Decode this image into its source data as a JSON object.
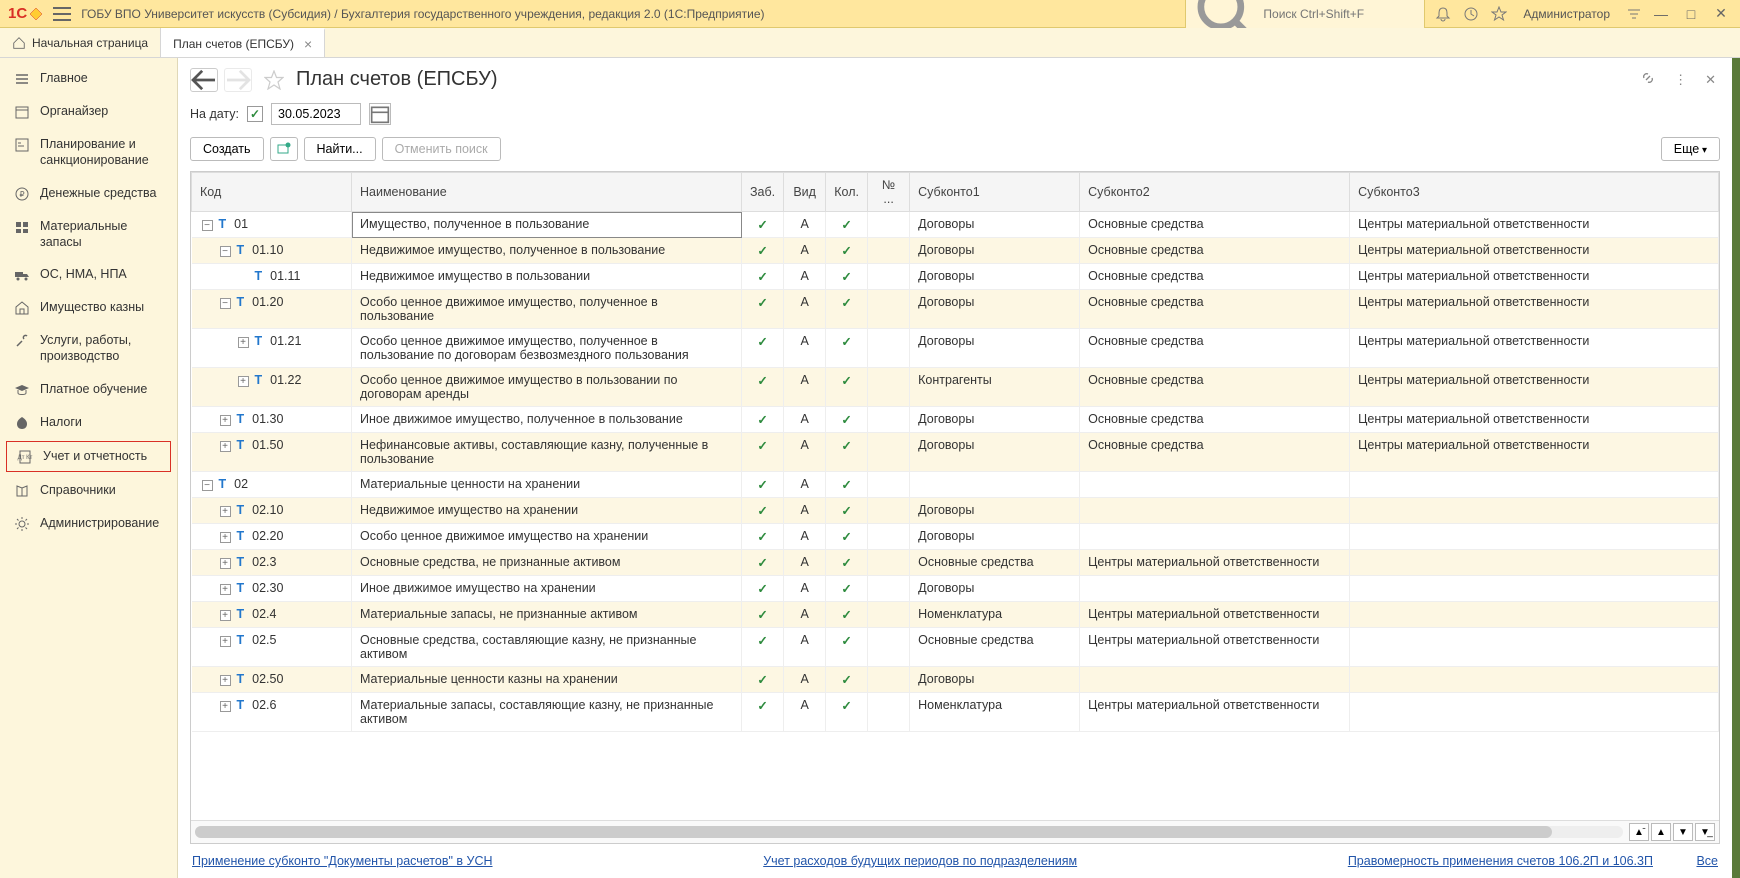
{
  "titlebar": {
    "title": "ГОБУ ВПО Университет искусств (Субсидия) / Бухгалтерия государственного учреждения, редакция 2.0  (1С:Предприятие)",
    "search_placeholder": "Поиск Ctrl+Shift+F",
    "admin": "Администратор"
  },
  "tabs": {
    "home": "Начальная страница",
    "open": "План счетов (ЕПСБУ)"
  },
  "sidebar": [
    {
      "label": "Главное",
      "icon": "lines"
    },
    {
      "label": "Органайзер",
      "icon": "calendar"
    },
    {
      "label": "Планирование и санкционирование",
      "icon": "plan"
    },
    {
      "label": "Денежные средства",
      "icon": "ruble"
    },
    {
      "label": "Материальные запасы",
      "icon": "boxes"
    },
    {
      "label": "ОС, НМА, НПА",
      "icon": "truck"
    },
    {
      "label": "Имущество казны",
      "icon": "building"
    },
    {
      "label": "Услуги, работы, производство",
      "icon": "tools"
    },
    {
      "label": "Платное обучение",
      "icon": "gradcap"
    },
    {
      "label": "Налоги",
      "icon": "eagle"
    },
    {
      "label": "Учет и отчетность",
      "icon": "report",
      "selected": true
    },
    {
      "label": "Справочники",
      "icon": "book"
    },
    {
      "label": "Администрирование",
      "icon": "gear"
    }
  ],
  "page": {
    "title": "План счетов (ЕПСБУ)",
    "date_label": "На дату:",
    "date_value": "30.05.2023",
    "date_checked": true
  },
  "toolbar": {
    "create": "Создать",
    "find": "Найти...",
    "cancel_search": "Отменить поиск",
    "more": "Еще"
  },
  "columns": {
    "code": "Код",
    "name": "Наименование",
    "zab": "Заб.",
    "vid": "Вид",
    "kol": "Кол.",
    "num": "№ ...",
    "sub1": "Субконто1",
    "sub2": "Субконто2",
    "sub3": "Субконто3"
  },
  "rows": [
    {
      "indent": 0,
      "toggle": "minus",
      "code": "01",
      "name": "Имущество, полученное в пользование",
      "zab": true,
      "vid": "А",
      "kol": true,
      "num": "",
      "sub1": "Договоры",
      "sub2": "Основные средства",
      "sub3": "Центры материальной ответственности",
      "selected": true,
      "even": false
    },
    {
      "indent": 1,
      "toggle": "minus",
      "code": "01.10",
      "name": "Недвижимое имущество, полученное в пользование",
      "zab": true,
      "vid": "А",
      "kol": true,
      "num": "",
      "sub1": "Договоры",
      "sub2": "Основные средства",
      "sub3": "Центры материальной ответственности",
      "even": true
    },
    {
      "indent": 2,
      "toggle": "empty",
      "code": "01.11",
      "name": "Недвижимое имущество в пользовании",
      "zab": true,
      "vid": "А",
      "kol": true,
      "num": "",
      "sub1": "Договоры",
      "sub2": "Основные средства",
      "sub3": "Центры материальной ответственности",
      "even": false
    },
    {
      "indent": 1,
      "toggle": "minus",
      "code": "01.20",
      "name": "Особо ценное движимое имущество, полученное в пользование",
      "zab": true,
      "vid": "А",
      "kol": true,
      "num": "",
      "sub1": "Договоры",
      "sub2": "Основные средства",
      "sub3": "Центры материальной ответственности",
      "even": true
    },
    {
      "indent": 2,
      "toggle": "plus",
      "code": "01.21",
      "name": "Особо ценное движимое имущество, полученное в пользование по договорам безвозмездного пользования",
      "zab": true,
      "vid": "А",
      "kol": true,
      "num": "",
      "sub1": "Договоры",
      "sub2": "Основные средства",
      "sub3": "Центры материальной ответственности",
      "even": false
    },
    {
      "indent": 2,
      "toggle": "plus",
      "code": "01.22",
      "name": "Особо ценное движимое имущество в пользовании по договорам аренды",
      "zab": true,
      "vid": "А",
      "kol": true,
      "num": "",
      "sub1": "Контрагенты",
      "sub2": "Основные средства",
      "sub3": "Центры материальной ответственности",
      "even": true
    },
    {
      "indent": 1,
      "toggle": "plus",
      "code": "01.30",
      "name": "Иное движимое имущество, полученное в пользование",
      "zab": true,
      "vid": "А",
      "kol": true,
      "num": "",
      "sub1": "Договоры",
      "sub2": "Основные средства",
      "sub3": "Центры материальной ответственности",
      "even": false
    },
    {
      "indent": 1,
      "toggle": "plus",
      "code": "01.50",
      "name": "Нефинансовые активы, составляющие казну, полученные в пользование",
      "zab": true,
      "vid": "А",
      "kol": true,
      "num": "",
      "sub1": "Договоры",
      "sub2": "Основные средства",
      "sub3": "Центры материальной ответственности",
      "even": true
    },
    {
      "indent": 0,
      "toggle": "minus",
      "code": "02",
      "name": "Материальные ценности на хранении",
      "zab": true,
      "vid": "А",
      "kol": true,
      "num": "",
      "sub1": "",
      "sub2": "",
      "sub3": "",
      "even": false
    },
    {
      "indent": 1,
      "toggle": "plus",
      "code": "02.10",
      "name": "Недвижимое имущество на хранении",
      "zab": true,
      "vid": "А",
      "kol": true,
      "num": "",
      "sub1": "Договоры",
      "sub2": "",
      "sub3": "",
      "even": true
    },
    {
      "indent": 1,
      "toggle": "plus",
      "code": "02.20",
      "name": "Особо ценное движимое имущество на хранении",
      "zab": true,
      "vid": "А",
      "kol": true,
      "num": "",
      "sub1": "Договоры",
      "sub2": "",
      "sub3": "",
      "even": false
    },
    {
      "indent": 1,
      "toggle": "plus",
      "code": "02.3",
      "name": "Основные средства, не признанные активом",
      "zab": true,
      "vid": "А",
      "kol": true,
      "num": "",
      "sub1": "Основные средства",
      "sub2": "Центры материальной ответственности",
      "sub3": "",
      "even": true
    },
    {
      "indent": 1,
      "toggle": "plus",
      "code": "02.30",
      "name": "Иное движимое имущество на хранении",
      "zab": true,
      "vid": "А",
      "kol": true,
      "num": "",
      "sub1": "Договоры",
      "sub2": "",
      "sub3": "",
      "even": false
    },
    {
      "indent": 1,
      "toggle": "plus",
      "code": "02.4",
      "name": "Материальные запасы, не признанные активом",
      "zab": true,
      "vid": "А",
      "kol": true,
      "num": "",
      "sub1": "Номенклатура",
      "sub2": "Центры материальной ответственности",
      "sub3": "",
      "even": true
    },
    {
      "indent": 1,
      "toggle": "plus",
      "code": "02.5",
      "name": "Основные средства, составляющие казну, не признанные активом",
      "zab": true,
      "vid": "А",
      "kol": true,
      "num": "",
      "sub1": "Основные средства",
      "sub2": "Центры материальной ответственности",
      "sub3": "",
      "even": false
    },
    {
      "indent": 1,
      "toggle": "plus",
      "code": "02.50",
      "name": "Материальные ценности казны на хранении",
      "zab": true,
      "vid": "А",
      "kol": true,
      "num": "",
      "sub1": "Договоры",
      "sub2": "",
      "sub3": "",
      "even": true
    },
    {
      "indent": 1,
      "toggle": "plus",
      "code": "02.6",
      "name": "Материальные запасы, составляющие казну, не признанные активом",
      "zab": true,
      "vid": "А",
      "kol": true,
      "num": "",
      "sub1": "Номенклатура",
      "sub2": "Центры материальной ответственности",
      "sub3": "",
      "even": false
    }
  ],
  "bottom_links": {
    "left": "Применение субконто \"Документы расчетов\" в УСН",
    "center": "Учет расходов будущих периодов по подразделениям",
    "right": "Правомерность применения счетов 106.2П и 106.3П",
    "all": "Все"
  }
}
